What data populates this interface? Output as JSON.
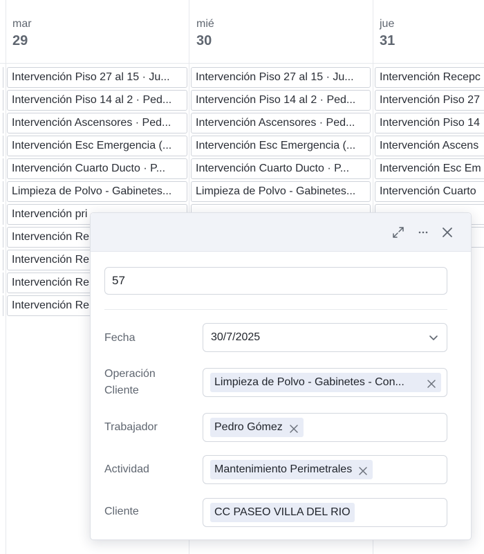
{
  "calendar": {
    "days": [
      {
        "name": "mar",
        "num": "29"
      },
      {
        "name": "mié",
        "num": "30"
      },
      {
        "name": "jue",
        "num": "31"
      }
    ],
    "col1_events": [
      "Intervención Piso 27 al 15 · Ju...",
      "Intervención Piso 14 al 2 · Ped...",
      "Intervención Ascensores · Ped...",
      "Intervención Esc Emergencia (...",
      "Intervención Cuarto Ducto · P...",
      "Limpieza de Polvo - Gabinetes...",
      "Intervención pri",
      "Intervención Re",
      "Intervención Re",
      "Intervención Re",
      "Intervención Re"
    ],
    "col2_events": [
      "Intervención Piso 27 al 15 · Ju...",
      "Intervención Piso 14 al 2 · Ped...",
      "Intervención Ascensores · Ped...",
      "Intervención Esc Emergencia (...",
      "Intervención Cuarto Ducto · P...",
      "Limpieza de Polvo - Gabinetes..."
    ],
    "col3_events": [
      "Intervención Recepc",
      "Intervención Piso 27",
      "Intervención Piso 14",
      "Intervención Ascens",
      "Intervención Esc Em",
      "Intervención Cuarto"
    ]
  },
  "panel": {
    "title": "57",
    "fields": {
      "fecha": {
        "label": "Fecha",
        "value": "30/7/2025"
      },
      "operacion": {
        "label_line1": "Operación",
        "label_line2": "Cliente",
        "value": "Limpieza de Polvo - Gabinetes - Con..."
      },
      "trabajador": {
        "label": "Trabajador",
        "value": "Pedro Gómez"
      },
      "actividad": {
        "label": "Actividad",
        "value": "Mantenimiento Perimetrales"
      },
      "cliente": {
        "label": "Cliente",
        "value": "CC PASEO VILLA DEL RIO"
      }
    },
    "icons": {
      "expand": "expand-icon",
      "more": "more-icon",
      "close": "close-icon",
      "dropdown": "chevron-down-icon",
      "remove": "x-icon"
    }
  }
}
